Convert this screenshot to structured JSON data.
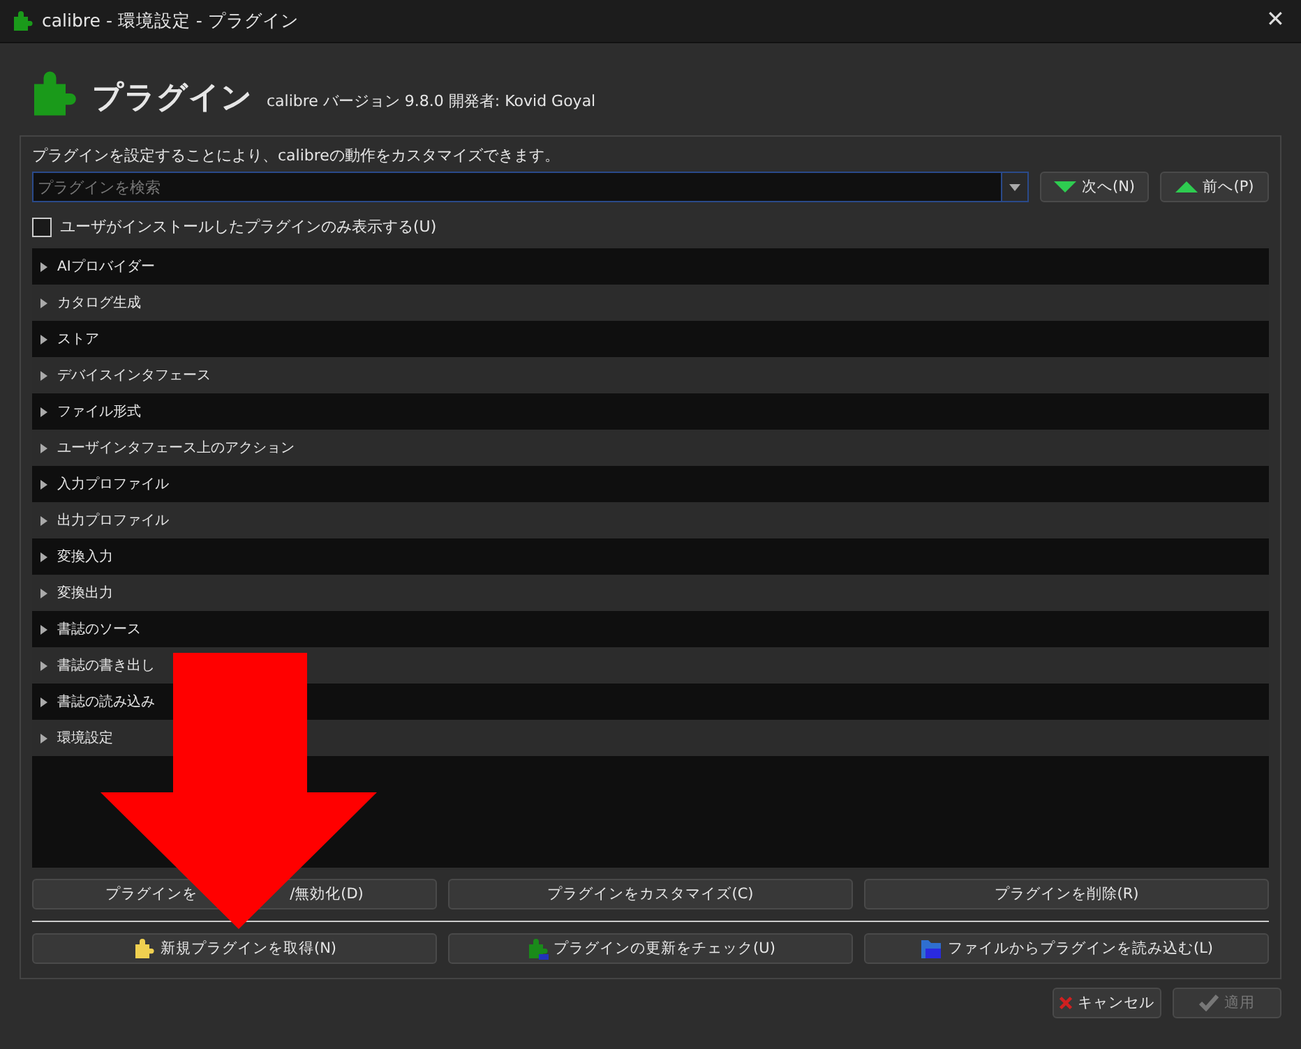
{
  "window": {
    "title": "calibre - 環境設定 - プラグイン",
    "close_glyph": "✕"
  },
  "header": {
    "title": "プラグイン",
    "subtitle": "calibre バージョン 9.8.0 開発者: Kovid Goyal"
  },
  "description": "プラグインを設定することにより、calibreの動作をカスタマイズできます。",
  "search": {
    "placeholder": "プラグインを検索"
  },
  "nav_buttons": [
    {
      "label": "次へ(N)",
      "kind": "next"
    },
    {
      "label": "前へ(P)",
      "kind": "prev"
    }
  ],
  "user_only": {
    "label": "ユーザがインストールしたプラグインのみ表示する(U)",
    "checked": false
  },
  "categories": [
    {
      "label": "AIプロバイダー",
      "expanded": false
    },
    {
      "label": "カタログ生成",
      "expanded": false
    },
    {
      "label": "ストア",
      "expanded": false
    },
    {
      "label": "デバイスインタフェース",
      "expanded": false
    },
    {
      "label": "ファイル形式",
      "expanded": false
    },
    {
      "label": "ユーザインタフェース上のアクション",
      "expanded": false
    },
    {
      "label": "入力プロファイル",
      "expanded": false
    },
    {
      "label": "出力プロファイル",
      "expanded": false
    },
    {
      "label": "変換入力",
      "expanded": false
    },
    {
      "label": "変換出力",
      "expanded": false
    },
    {
      "label": "書誌のソース",
      "expanded": false
    },
    {
      "label": "書誌の書き出し",
      "expanded": false
    },
    {
      "label": "書誌の読み込み",
      "expanded": false
    },
    {
      "label": "環境設定",
      "expanded": false
    }
  ],
  "action_buttons": [
    {
      "label_parts": [
        "プラグインを",
        "/無効化(D)"
      ]
    },
    {
      "label_parts": [
        "プラグインをカスタマイズ(C)"
      ]
    },
    {
      "label_parts": [
        "プラグインを削除(R)"
      ]
    }
  ],
  "plugin_buttons": [
    {
      "label": "新規プラグインを取得(N)",
      "kind": "get"
    },
    {
      "label": "プラグインの更新をチェック(U)",
      "kind": "update"
    },
    {
      "label": "ファイルからプラグインを読み込む(L)",
      "kind": "file"
    }
  ],
  "dialog_buttons": [
    {
      "label": "キャンセル",
      "kind": "cancel",
      "disabled": false
    },
    {
      "label": "適用",
      "kind": "apply",
      "disabled": true
    }
  ]
}
